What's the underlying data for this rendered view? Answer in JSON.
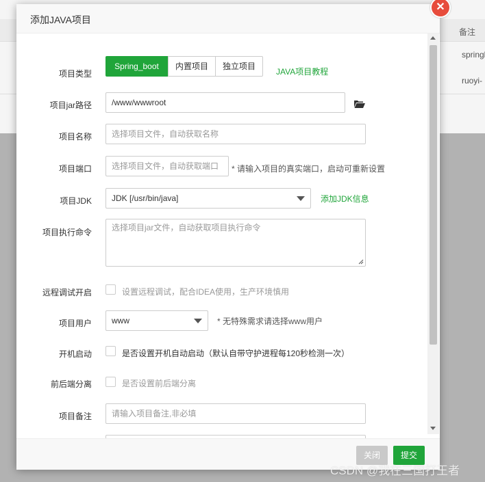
{
  "background": {
    "column_header": "备注",
    "rows": [
      "springb",
      "ruoyi-"
    ]
  },
  "dialog": {
    "title": "添加JAVA项目",
    "close_icon": "close-icon",
    "fields": {
      "type": {
        "label": "项目类型",
        "options": [
          "Spring_boot",
          "内置项目",
          "独立项目"
        ],
        "selected": "Spring_boot",
        "tutorial_link": "JAVA项目教程"
      },
      "jar_path": {
        "label": "项目jar路径",
        "value": "/www/wwwroot",
        "icon": "folder-open-icon"
      },
      "name": {
        "label": "项目名称",
        "placeholder": "选择项目文件，自动获取名称"
      },
      "port": {
        "label": "项目端口",
        "placeholder": "选择项目文件，自动获取端口",
        "hint": "* 请输入项目的真实端口，启动可重新设置"
      },
      "jdk": {
        "label": "项目JDK",
        "value": "JDK [/usr/bin/java]",
        "link": "添加JDK信息"
      },
      "command": {
        "label": "项目执行命令",
        "placeholder": "选择项目jar文件，自动获取项目执行命令"
      },
      "remote_debug": {
        "label": "远程调试开启",
        "text": "设置远程调试，配合IDEA使用，生产环境慎用",
        "checked": false
      },
      "user": {
        "label": "项目用户",
        "value": "www",
        "hint": "* 无特殊需求请选择www用户"
      },
      "autostart": {
        "label": "开机启动",
        "text": "是否设置开机自动启动（默认自带守护进程每120秒检测一次）",
        "checked": false
      },
      "separation": {
        "label": "前后端分离",
        "text": "是否设置前后端分离",
        "checked": false
      },
      "remark": {
        "label": "项目备注",
        "placeholder": "请输入项目备注,非必填"
      }
    },
    "footer": {
      "close_label": "关闭",
      "submit_label": "提交"
    }
  },
  "watermark": "CSDN @我在三国打王者",
  "colors": {
    "accent": "#20a53a",
    "close": "#e74c3c"
  }
}
